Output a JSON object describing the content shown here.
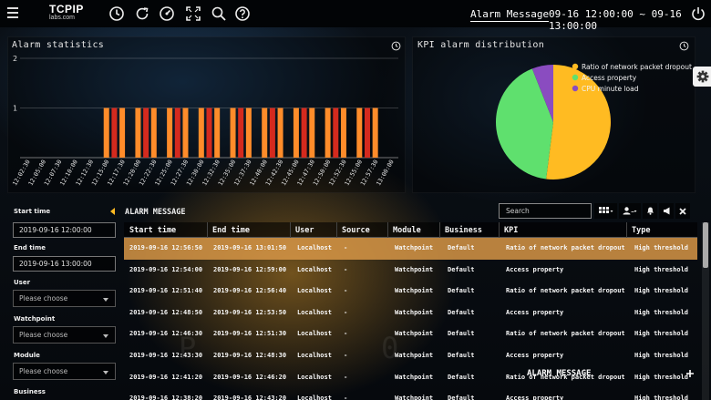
{
  "header": {
    "logo_line1": "TCPIP",
    "logo_line2": "labs.com",
    "title": "Alarm Message",
    "time_range": "09-16 12:00:00 ~ 09-16 13:00:00",
    "icons": [
      "menu-icon",
      "clock-icon",
      "refresh-icon",
      "speed-icon",
      "fullscreen-icon",
      "search-icon",
      "help-icon",
      "power-icon"
    ]
  },
  "alarm_stats": {
    "title": "Alarm statistics"
  },
  "kpi": {
    "title": "KPI alarm distribution"
  },
  "chart_data": [
    {
      "type": "bar",
      "title": "Alarm statistics",
      "ylim": [
        0,
        2
      ],
      "yticks": [
        "0",
        "1",
        "2"
      ],
      "grid": true,
      "categories": [
        "12:02:30",
        "12:05:00",
        "12:07:30",
        "12:10:00",
        "12:12:30",
        "12:15:00",
        "12:17:30",
        "12:20:00",
        "12:22:30",
        "12:25:00",
        "12:27:30",
        "12:30:00",
        "12:32:30",
        "12:35:00",
        "12:37:30",
        "12:40:00",
        "12:42:30",
        "12:45:00",
        "12:47:30",
        "12:50:00",
        "12:52:30",
        "12:55:00",
        "12:57:30",
        "13:00:00"
      ],
      "bars": [
        {
          "x": "12:15:00",
          "value": 1,
          "color": "#ff8c2a"
        },
        {
          "x": "12:17:30",
          "value": 1,
          "color": "#ff8c2a"
        },
        {
          "x": "12:20:00",
          "value": 1,
          "color": "#ff8c2a"
        },
        {
          "x": "12:22:30",
          "value": 1,
          "color": "#ff8c2a"
        },
        {
          "x": "12:25:00",
          "value": 1,
          "color": "#ff8c2a"
        },
        {
          "x": "12:27:30",
          "value": 1,
          "color": "#ff8c2a"
        },
        {
          "x": "12:30:00",
          "value": 1,
          "color": "#ff8c2a"
        },
        {
          "x": "12:32:30",
          "value": 1,
          "color": "#ff8c2a"
        },
        {
          "x": "12:35:00",
          "value": 1,
          "color": "#ff8c2a"
        },
        {
          "x": "12:37:30",
          "value": 1,
          "color": "#ff8c2a"
        },
        {
          "x": "12:40:00",
          "value": 1,
          "color": "#ff8c2a"
        },
        {
          "x": "12:42:30",
          "value": 1,
          "color": "#ff8c2a"
        },
        {
          "x": "12:45:00",
          "value": 1,
          "color": "#ff8c2a"
        },
        {
          "x": "12:47:30",
          "value": 1,
          "color": "#ff8c2a"
        },
        {
          "x": "12:50:00",
          "value": 1,
          "color": "#ff8c2a"
        },
        {
          "x": "12:52:30",
          "value": 1,
          "color": "#ff8c2a"
        },
        {
          "x": "12:55:00",
          "value": 1,
          "color": "#ff8c2a"
        },
        {
          "x": "12:57:30",
          "value": 1,
          "color": "#ff8c2a"
        },
        {
          "x": "12:16:15",
          "value": 1,
          "color": "#d42a1e"
        },
        {
          "x": "12:21:15",
          "value": 1,
          "color": "#d42a1e"
        },
        {
          "x": "12:26:15",
          "value": 1,
          "color": "#d42a1e"
        },
        {
          "x": "12:31:15",
          "value": 1,
          "color": "#d42a1e"
        },
        {
          "x": "12:36:15",
          "value": 1,
          "color": "#d42a1e"
        },
        {
          "x": "12:41:15",
          "value": 1,
          "color": "#d42a1e"
        },
        {
          "x": "12:46:15",
          "value": 1,
          "color": "#d42a1e"
        },
        {
          "x": "12:51:15",
          "value": 1,
          "color": "#d42a1e"
        },
        {
          "x": "12:56:15",
          "value": 1,
          "color": "#d42a1e"
        }
      ]
    },
    {
      "type": "pie",
      "title": "KPI alarm distribution",
      "legend_position": "top-right",
      "slices": [
        {
          "name": "Ratio of network packet dropout",
          "value": 52,
          "color": "#ffbb22"
        },
        {
          "name": "Access property",
          "value": 42,
          "color": "#5fe06e"
        },
        {
          "name": "CPU minute load",
          "value": 6,
          "color": "#8a4cc0"
        }
      ]
    }
  ],
  "filters": {
    "start_time_label": "Start time",
    "start_time_value": "2019-09-16 12:00:00",
    "end_time_label": "End time",
    "end_time_value": "2019-09-16 13:00:00",
    "user_label": "User",
    "user_placeholder": "Please choose",
    "watchpoint_label": "Watchpoint",
    "watchpoint_placeholder": "Please choose",
    "module_label": "Module",
    "module_placeholder": "Please choose",
    "business_label": "Business"
  },
  "alarm_table": {
    "title": "ALARM MESSAGE",
    "search_placeholder": "Search",
    "columns": [
      "Start time",
      "End time",
      "User",
      "Source",
      "Module",
      "Business",
      "KPI",
      "Type"
    ],
    "rows": [
      [
        "2019-09-16 12:56:50",
        "2019-09-16 13:01:50",
        "Localhost",
        "-",
        "Watchpoint",
        "Default",
        "Ratio of network packet dropout",
        "High threshold"
      ],
      [
        "2019-09-16 12:54:00",
        "2019-09-16 12:59:00",
        "Localhost",
        "-",
        "Watchpoint",
        "Default",
        "Access property",
        "High threshold"
      ],
      [
        "2019-09-16 12:51:40",
        "2019-09-16 12:56:40",
        "Localhost",
        "-",
        "Watchpoint",
        "Default",
        "Ratio of network packet dropout",
        "High threshold"
      ],
      [
        "2019-09-16 12:48:50",
        "2019-09-16 12:53:50",
        "Localhost",
        "-",
        "Watchpoint",
        "Default",
        "Access property",
        "High threshold"
      ],
      [
        "2019-09-16 12:46:30",
        "2019-09-16 12:51:30",
        "Localhost",
        "-",
        "Watchpoint",
        "Default",
        "Ratio of network packet dropout",
        "High threshold"
      ],
      [
        "2019-09-16 12:43:30",
        "2019-09-16 12:48:30",
        "Localhost",
        "-",
        "Watchpoint",
        "Default",
        "Access property",
        "High threshold"
      ],
      [
        "2019-09-16 12:41:20",
        "2019-09-16 12:46:20",
        "Localhost",
        "-",
        "Watchpoint",
        "Default",
        "Ratio of network packet dropout",
        "High threshold"
      ],
      [
        "2019-09-16 12:38:20",
        "2019-09-16 12:43:20",
        "Localhost",
        "-",
        "Watchpoint",
        "Default",
        "Access property",
        "High threshold"
      ]
    ],
    "selected_row": 0
  },
  "footer": {
    "label": "ALARM MESSAGE"
  },
  "colors": {
    "accent": "#ffbb22",
    "selected_row": "#d79646"
  }
}
